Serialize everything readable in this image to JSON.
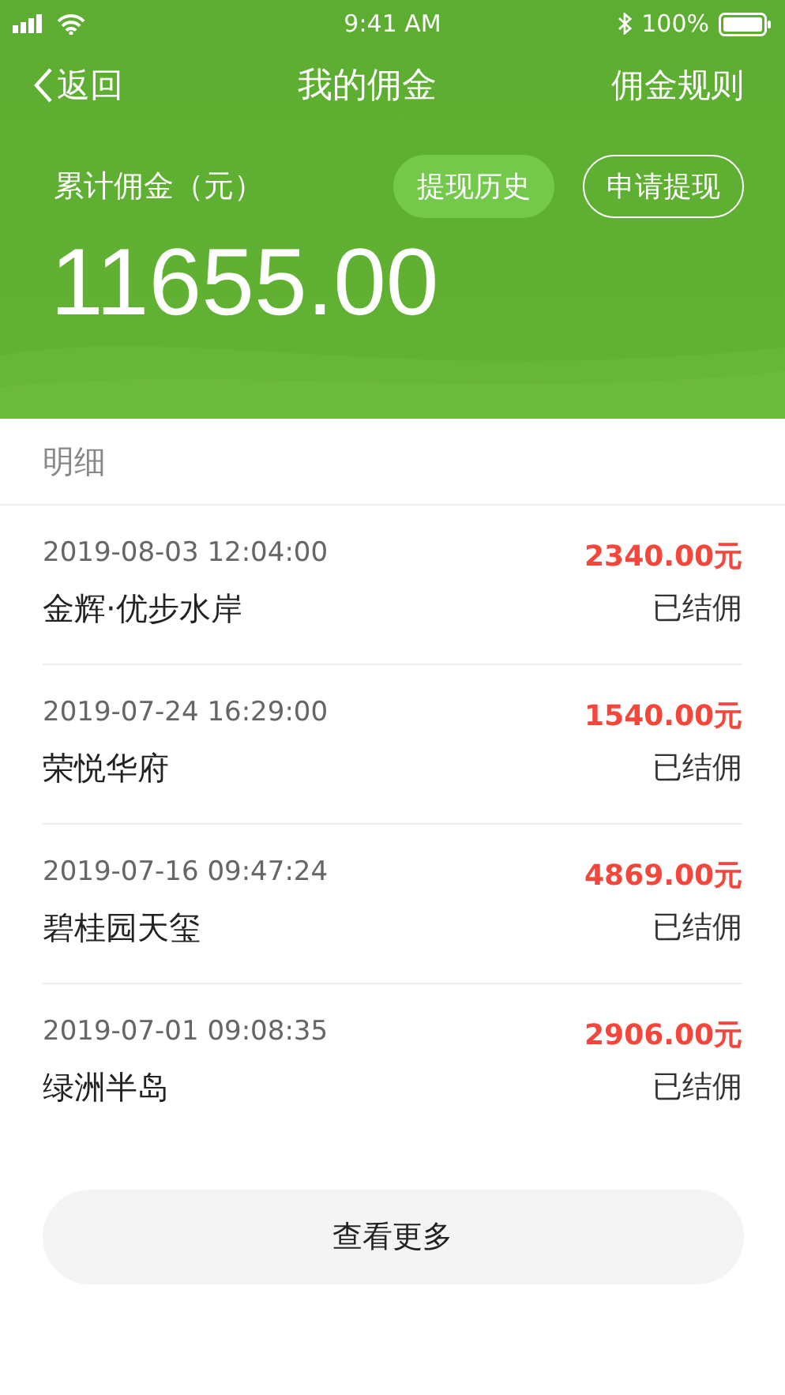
{
  "status_bar": {
    "time": "9:41 AM",
    "battery": "100%"
  },
  "nav": {
    "back": "返回",
    "title": "我的佣金",
    "action": "佣金规则"
  },
  "summary": {
    "label": "累计佣金（元）",
    "amount": "11655.00",
    "buttons": [
      {
        "label": "提现历史",
        "kind": "filled"
      },
      {
        "label": "申请提现",
        "kind": "outlined"
      }
    ]
  },
  "section_title": "明细",
  "records": [
    {
      "time": "2019-08-03 12:04:00",
      "name": "金辉·优步水岸",
      "amount": "2340.00元",
      "status": "已结佣"
    },
    {
      "time": "2019-07-24 16:29:00",
      "name": "荣悦华府",
      "amount": "1540.00元",
      "status": "已结佣"
    },
    {
      "time": "2019-07-16 09:47:24",
      "name": "碧桂园天玺",
      "amount": "4869.00元",
      "status": "已结佣"
    },
    {
      "time": "2019-07-01 09:08:35",
      "name": "绿洲半岛",
      "amount": "2906.00元",
      "status": "已结佣"
    }
  ],
  "more_button": "查看更多"
}
